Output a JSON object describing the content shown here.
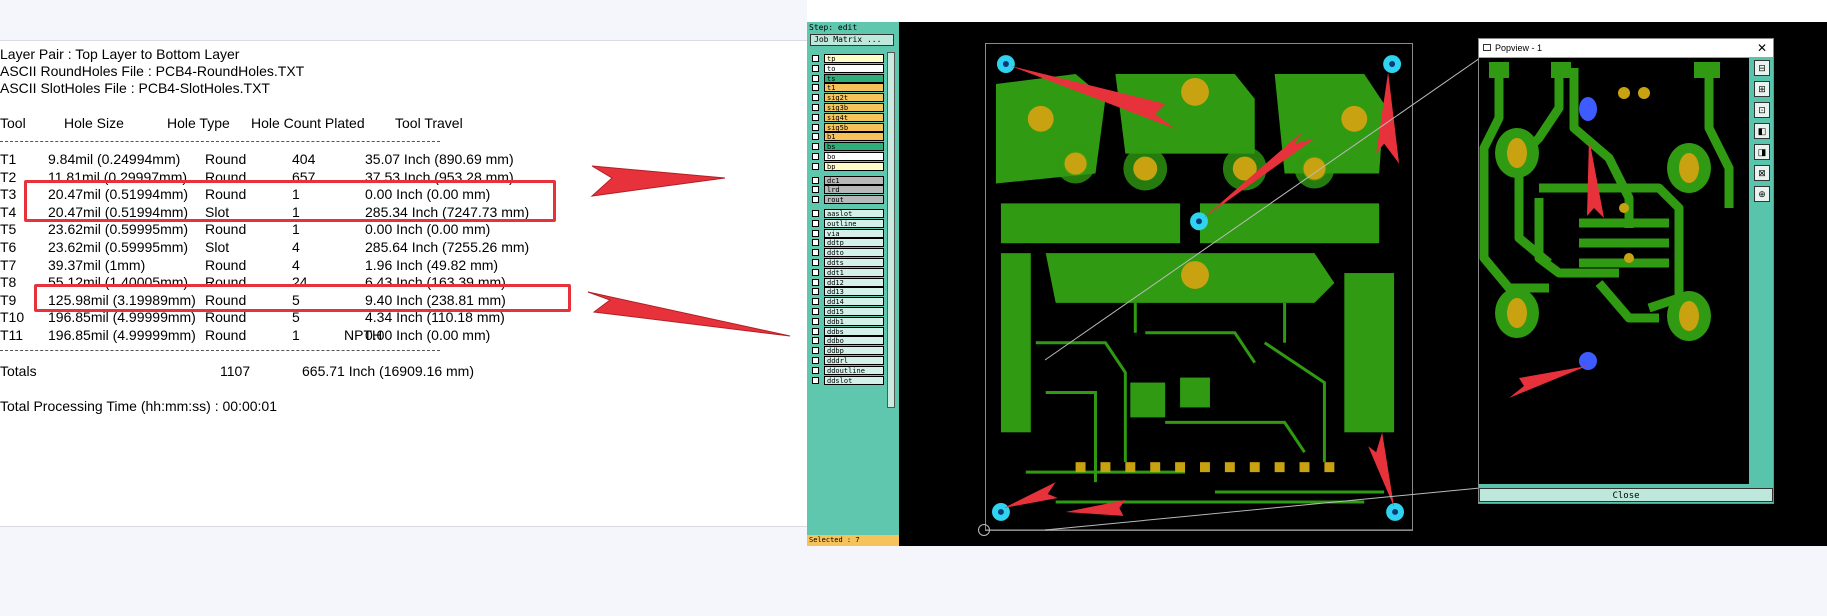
{
  "report": {
    "layer_pair": "Layer Pair : Top Layer to Bottom Layer",
    "round_file": "ASCII RoundHoles File : PCB4-RoundHoles.TXT",
    "slot_file": "ASCII SlotHoles File : PCB4-SlotHoles.TXT",
    "headers": {
      "tool": "Tool",
      "size": "Hole Size",
      "type": "Hole Type",
      "count": "Hole Count Plated",
      "travel": "Tool Travel"
    },
    "rows": [
      {
        "tool": "T1",
        "size": "9.84mil (0.24994mm)",
        "type": "Round",
        "count": "404",
        "plated": "",
        "travel": "35.07 Inch (890.69 mm)"
      },
      {
        "tool": "T2",
        "size": "11.81mil (0.29997mm)",
        "type": "Round",
        "count": "657",
        "plated": "",
        "travel": "37.53 Inch (953.28 mm)"
      },
      {
        "tool": "T3",
        "size": "20.47mil (0.51994mm)",
        "type": "Round",
        "count": "1",
        "plated": "",
        "travel": "0.00 Inch (0.00 mm)"
      },
      {
        "tool": "T4",
        "size": "20.47mil (0.51994mm)",
        "type": "Slot",
        "count": "1",
        "plated": "",
        "travel": "285.34 Inch (7247.73 mm)"
      },
      {
        "tool": "T5",
        "size": "23.62mil (0.59995mm)",
        "type": "Round",
        "count": "1",
        "plated": "",
        "travel": "0.00 Inch (0.00 mm)"
      },
      {
        "tool": "T6",
        "size": "23.62mil (0.59995mm)",
        "type": "Slot",
        "count": "4",
        "plated": "",
        "travel": "285.64 Inch (7255.26 mm)"
      },
      {
        "tool": "T7",
        "size": "39.37mil (1mm)",
        "type": "Round",
        "count": "4",
        "plated": "",
        "travel": "1.96 Inch (49.82 mm)"
      },
      {
        "tool": "T8",
        "size": "55.12mil (1.40005mm)",
        "type": "Round",
        "count": "24",
        "plated": "",
        "travel": "6.43 Inch (163.39 mm)"
      },
      {
        "tool": "T9",
        "size": "125.98mil (3.19989mm)",
        "type": "Round",
        "count": "5",
        "plated": "",
        "travel": "9.40 Inch (238.81 mm)"
      },
      {
        "tool": "T10",
        "size": "196.85mil (4.99999mm)",
        "type": "Round",
        "count": "5",
        "plated": "",
        "travel": "4.34 Inch (110.18 mm)"
      },
      {
        "tool": "T11",
        "size": "196.85mil (4.99999mm)",
        "type": "Round",
        "count": "1",
        "plated": "NPTH",
        "travel": "0.00 Inch (0.00 mm)"
      }
    ],
    "totals": {
      "label": "Totals",
      "count": "1107",
      "travel": "665.71 Inch (16909.16 mm)"
    },
    "processing": "Total Processing Time (hh:mm:ss) : 00:00:01"
  },
  "cam": {
    "step_label": "Step: edit",
    "job_matrix": "Job Matrix ...",
    "selected": "Selected : 7",
    "layers": [
      {
        "name": "tp",
        "color": "#fffdc8"
      },
      {
        "name": "to",
        "color": "#ffffff"
      },
      {
        "name": "ts",
        "color": "#2fae7a"
      },
      {
        "name": "t1",
        "color": "#f6c35a"
      },
      {
        "name": "sig2t",
        "color": "#f6c35a"
      },
      {
        "name": "sig3b",
        "color": "#f6c35a"
      },
      {
        "name": "sig4t",
        "color": "#f6c35a"
      },
      {
        "name": "sig5b",
        "color": "#f6c35a"
      },
      {
        "name": "b1",
        "color": "#f6c35a"
      },
      {
        "name": "bs",
        "color": "#2fae7a"
      },
      {
        "name": "bo",
        "color": "#ffffff"
      },
      {
        "name": "bp",
        "color": "#fffdc8"
      },
      {
        "name": "dc1",
        "color": "#b8b8b8"
      },
      {
        "name": "lrd",
        "color": "#b8b8b8"
      },
      {
        "name": "rout",
        "color": "#b8b8b8"
      },
      {
        "name": "aaslot",
        "color": "#d4f0e8"
      },
      {
        "name": "outline",
        "color": "#d4f0e8"
      },
      {
        "name": "via",
        "color": "#d4f0e8"
      },
      {
        "name": "ddtp",
        "color": "#d4f0e8"
      },
      {
        "name": "ddto",
        "color": "#d4f0e8"
      },
      {
        "name": "ddts",
        "color": "#d4f0e8"
      },
      {
        "name": "ddt1",
        "color": "#d4f0e8"
      },
      {
        "name": "dd12",
        "color": "#d4f0e8"
      },
      {
        "name": "dd13",
        "color": "#d4f0e8"
      },
      {
        "name": "dd14",
        "color": "#d4f0e8"
      },
      {
        "name": "dd15",
        "color": "#d4f0e8"
      },
      {
        "name": "ddb1",
        "color": "#d4f0e8"
      },
      {
        "name": "ddbs",
        "color": "#d4f0e8"
      },
      {
        "name": "ddbo",
        "color": "#d4f0e8"
      },
      {
        "name": "ddbp",
        "color": "#d4f0e8"
      },
      {
        "name": "dddrl",
        "color": "#d4f0e8"
      },
      {
        "name": "ddoutline",
        "color": "#d4f0e8"
      },
      {
        "name": "ddslot",
        "color": "#d4f0e8"
      }
    ],
    "popview": {
      "title": "Popview - 1",
      "close_label": "Close"
    },
    "colors": {
      "copper": "#2f9a12",
      "pad": "#c8a210",
      "hole": "#2fd3f0",
      "arrow": "#e8323b",
      "panel": "#5fc7ad"
    }
  }
}
